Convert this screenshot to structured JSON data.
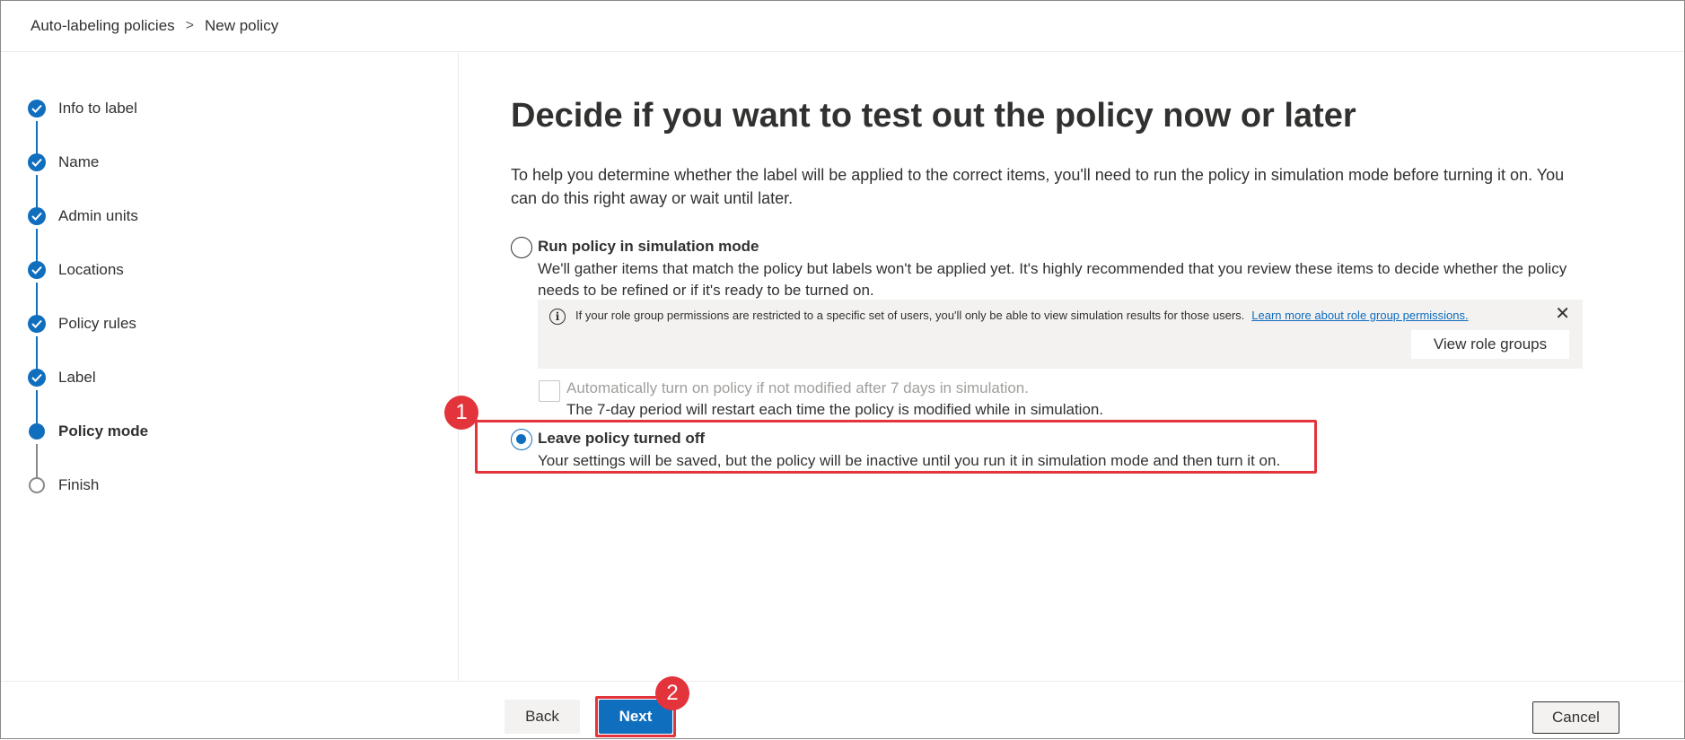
{
  "breadcrumb": {
    "parent": "Auto-labeling policies",
    "separator": ">",
    "current": "New policy"
  },
  "wizard": {
    "steps": [
      {
        "label": "Info to label",
        "state": "done"
      },
      {
        "label": "Name",
        "state": "done"
      },
      {
        "label": "Admin units",
        "state": "done"
      },
      {
        "label": "Locations",
        "state": "done"
      },
      {
        "label": "Policy rules",
        "state": "done"
      },
      {
        "label": "Label",
        "state": "done"
      },
      {
        "label": "Policy mode",
        "state": "current"
      },
      {
        "label": "Finish",
        "state": "todo"
      }
    ]
  },
  "main": {
    "title": "Decide if you want to test out the policy now or later",
    "intro": "To help you determine whether the label will be applied to the correct items, you'll need to run the policy in simulation mode before turning it on. You can do this right away or wait until later.",
    "options": [
      {
        "title": "Run policy in simulation mode",
        "description": "We'll gather items that match the policy but labels won't be applied yet. It's highly recommended that you review these items to decide whether the policy needs to be refined or if it's ready to be turned on.",
        "selected": false
      },
      {
        "title": "Leave policy turned off",
        "description": "Your settings will be saved, but the policy will be inactive until you run it in simulation mode and then turn it on.",
        "selected": true
      }
    ],
    "infobar": {
      "message": "If your role group permissions are restricted to a specific set of users, you'll only be able to view simulation results for those users.",
      "link": "Learn more about role group permissions.",
      "button": "View role groups",
      "close_icon": "close-icon",
      "info_icon": "info-icon",
      "info_glyph": "i",
      "close_glyph": "✕"
    },
    "auto_turn_on": {
      "label": "Automatically turn on policy if not modified after 7 days in simulation.",
      "description": "The 7-day period will restart each time the policy is modified while in simulation.",
      "checked": false,
      "disabled": true
    }
  },
  "annotations": {
    "marker_1": "1",
    "marker_2": "2",
    "color": "#e3343c"
  },
  "footer": {
    "back": "Back",
    "next": "Next",
    "cancel": "Cancel"
  },
  "colors": {
    "accent": "#106ebe",
    "text": "#323130",
    "infobar_bg": "#f3f2f1"
  }
}
